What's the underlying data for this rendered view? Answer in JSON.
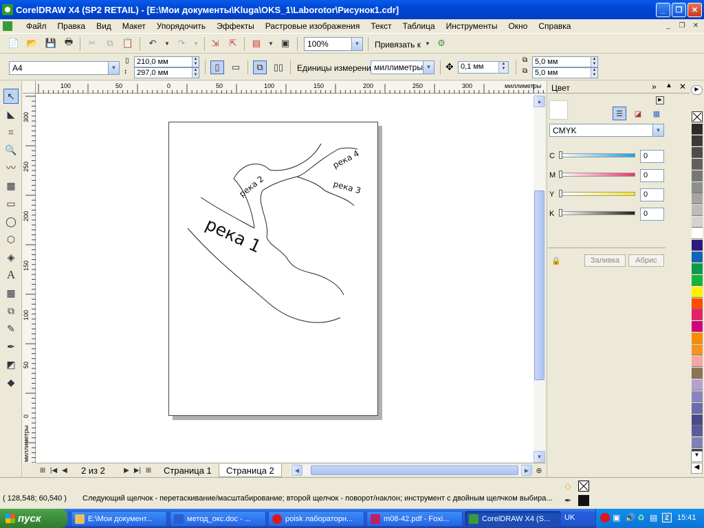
{
  "window": {
    "title": "CorelDRAW X4 (SP2 RETAIL) - [E:\\Мои документы\\Kluga\\OKS_1\\Laborotor\\Рисунок1.cdr]",
    "min": "_",
    "max": "❐",
    "close": "✕"
  },
  "menu": [
    "Файл",
    "Правка",
    "Вид",
    "Макет",
    "Упорядочить",
    "Эффекты",
    "Растровые изображения",
    "Текст",
    "Таблица",
    "Инструменты",
    "Окно",
    "Справка"
  ],
  "toolbar": {
    "zoom": "100%",
    "snap_label": "Привязать к"
  },
  "propbar": {
    "paper": "A4",
    "width": "210,0 мм",
    "height": "297,0 мм",
    "units_label": "Единицы измерения:",
    "units": "миллиметры",
    "nudge": "0,1 мм",
    "dup_x": "5,0 мм",
    "dup_y": "5,0 мм"
  },
  "rulers": {
    "h_ticks": [
      "100",
      "50",
      "0",
      "50",
      "100",
      "150",
      "200",
      "250",
      "300"
    ],
    "h_unit": "миллиметры",
    "v_ticks": [
      "300",
      "250",
      "200",
      "150",
      "100",
      "50",
      "0"
    ],
    "v_unit": "миллиметры"
  },
  "drawing": {
    "labels": [
      "река 1",
      "река 2",
      "река 3",
      "река 4"
    ]
  },
  "pager": {
    "count": "2 из 2",
    "tabs": [
      "Страница 1",
      "Страница 2"
    ]
  },
  "docker": {
    "title": "Цвет",
    "model": "CMYK",
    "channels": [
      {
        "name": "C",
        "value": "0",
        "color": "#1ea0e6"
      },
      {
        "name": "M",
        "value": "0",
        "color": "#e8386a"
      },
      {
        "name": "Y",
        "value": "0",
        "color": "#f5e628"
      },
      {
        "name": "K",
        "value": "0",
        "color": "#222222"
      }
    ],
    "fill_btn": "Заливка",
    "outline_btn": "Абрис"
  },
  "palette": [
    "#2b2b2b",
    "#3a3a3a",
    "#4d4d4d",
    "#606060",
    "#777777",
    "#8e8e8e",
    "#a5a5a5",
    "#bcbcbc",
    "#d3d3d3",
    "#ffffff",
    "#2d1a7a",
    "#1463b8",
    "#0a9a48",
    "#12b538",
    "#fff200",
    "#ff4a00",
    "#e8206a",
    "#d4007a",
    "#ff8a00",
    "#f7941d",
    "#f4a6a0",
    "#8b7355",
    "#b5a0d0",
    "#8a84c0",
    "#6b6bb0",
    "#4a4a8a",
    "#5a5a9a",
    "#8080b8",
    "#404060"
  ],
  "status": {
    "coords": "( 128,548; 60,540 )",
    "hint": "Следующий щелчок - перетаскивание/масштабирование; второй щелчок - поворот/наклон; инструмент с двойным щелчком выбира..."
  },
  "taskbar": {
    "start": "пуск",
    "items": [
      {
        "label": "E:\\Мои документ...",
        "color": "#e8c060"
      },
      {
        "label": "метод_окс.doc - ...",
        "color": "#2a5bd0"
      },
      {
        "label": "poisk лабораторн...",
        "color": "#d81a1a"
      },
      {
        "label": "m08-42.pdf - Foxi...",
        "color": "#c02060"
      },
      {
        "label": "CorelDRAW X4 (S...",
        "color": "#3a9a3a"
      }
    ],
    "lang": "UK",
    "clock": "15:41"
  }
}
